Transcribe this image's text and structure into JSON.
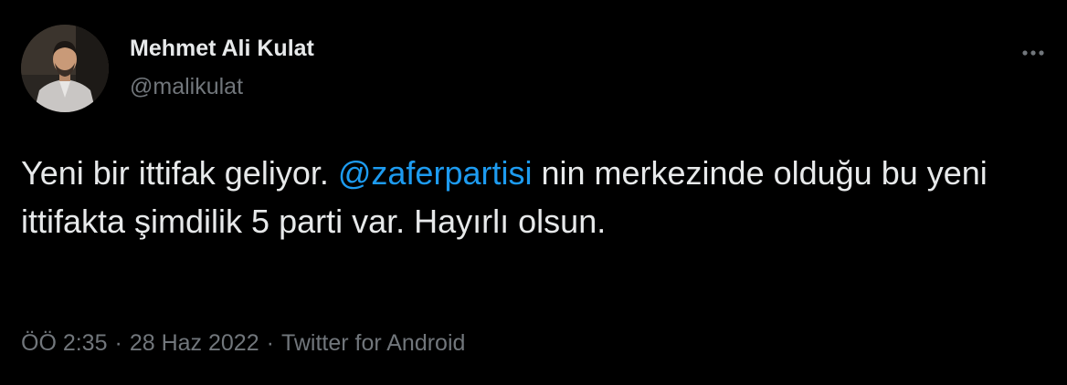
{
  "author": {
    "name": "Mehmet Ali Kulat",
    "handle": "@malikulat"
  },
  "tweet": {
    "text_before": "Yeni bir ittifak geliyor. ",
    "mention": "@zaferpartisi",
    "text_after": " nin merkezinde olduğu bu yeni ittifakta şimdilik 5 parti var. Hayırlı olsun."
  },
  "meta": {
    "time": "ÖÖ 2:35",
    "separator": "·",
    "date": "28 Haz 2022",
    "source": "Twitter for Android"
  },
  "icons": {
    "more": "more-horizontal-icon"
  },
  "colors": {
    "background": "#000000",
    "text_primary": "#e7e9ea",
    "text_secondary": "#71767b",
    "link": "#1d9bf0"
  }
}
